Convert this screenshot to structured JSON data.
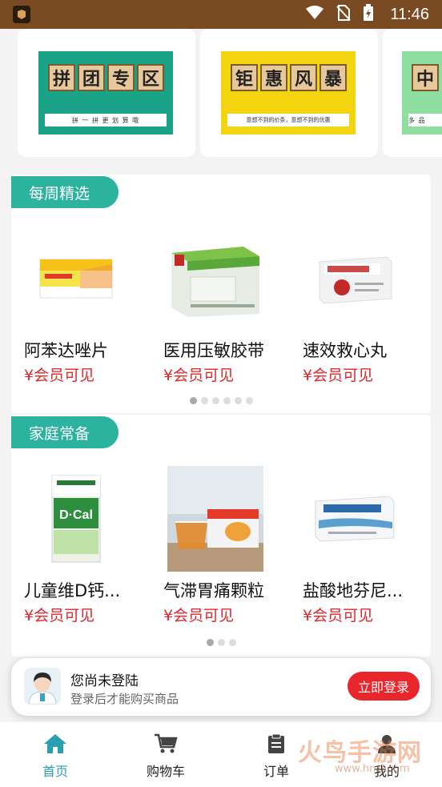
{
  "status_bar": {
    "time": "11:46"
  },
  "promos": [
    {
      "title_chars": [
        "拼",
        "团",
        "专",
        "区"
      ],
      "subtitle": "拼 一 拼   更 划 算 哦",
      "bg": "#1aa387"
    },
    {
      "title_chars": [
        "钜",
        "惠",
        "风",
        "暴"
      ],
      "subtitle": "意想不到的价条，意想不到的优惠",
      "bg": "#f2d411"
    },
    {
      "title_chars": [
        "中"
      ],
      "subtitle": "多 品",
      "bg": "#8fe0a0"
    }
  ],
  "sections": [
    {
      "title": "每周精选",
      "products": [
        {
          "name": "阿苯达唑片",
          "price": "¥会员可见",
          "image_label": "阿苯达唑片"
        },
        {
          "name": "医用压敏胶带",
          "price": "¥会员可见",
          "image_label": "医用橡皮膏"
        },
        {
          "name": "速效救心丸",
          "price": "¥会员可见",
          "image_label": "速效救心丸"
        }
      ]
    },
    {
      "title": "家庭常备",
      "products": [
        {
          "name": "儿童维D钙...",
          "price": "¥会员可见",
          "image_label": "D·Cal"
        },
        {
          "name": "气滞胃痛颗粒",
          "price": "¥会员可见",
          "image_label": "气滞胃痛颗粒"
        },
        {
          "name": "盐酸地芬尼...",
          "price": "¥会员可见",
          "image_label": "盐酸地芬尼多片"
        }
      ]
    }
  ],
  "login_prompt": {
    "title": "您尚未登陆",
    "subtitle": "登录后才能购买商品",
    "button": "立即登录"
  },
  "nav": [
    {
      "label": "首页",
      "icon": "home-icon"
    },
    {
      "label": "购物车",
      "icon": "cart-icon"
    },
    {
      "label": "订单",
      "icon": "order-icon"
    },
    {
      "label": "我的",
      "icon": "profile-icon"
    }
  ],
  "watermark": {
    "text": "火鸟手游网",
    "url": "www.hnzj.com"
  },
  "colors": {
    "accent_teal": "#2bb3a0",
    "price_red": "#e0262b",
    "login_red": "#e8262b",
    "status_brown": "#7a4a22"
  }
}
